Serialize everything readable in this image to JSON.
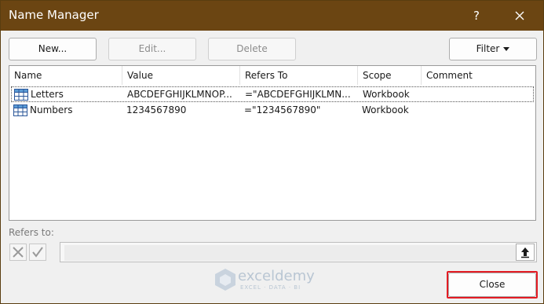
{
  "dialog": {
    "title": "Name Manager",
    "help_label": "?",
    "colors": {
      "titlebar": "#6b4512",
      "highlight": "#e31b23"
    }
  },
  "toolbar": {
    "new_label": "New...",
    "edit_label": "Edit...",
    "delete_label": "Delete",
    "filter_label": "Filter"
  },
  "table": {
    "columns": [
      "Name",
      "Value",
      "Refers To",
      "Scope",
      "Comment"
    ],
    "rows": [
      {
        "icon": "name-range-icon",
        "name": "Letters",
        "value": "ABCDEFGHIJKLMNOP...",
        "refers_to": "=\"ABCDEFGHIJKLMN...",
        "scope": "Workbook",
        "comment": ""
      },
      {
        "icon": "name-range-icon",
        "name": "Numbers",
        "value": "1234567890",
        "refers_to": "=\"1234567890\"",
        "scope": "Workbook",
        "comment": ""
      }
    ]
  },
  "refers": {
    "label": "Refers to:",
    "value": ""
  },
  "watermark": {
    "brand": "exceldemy",
    "tagline": "EXCEL · DATA · BI"
  },
  "footer": {
    "close_label": "Close"
  }
}
